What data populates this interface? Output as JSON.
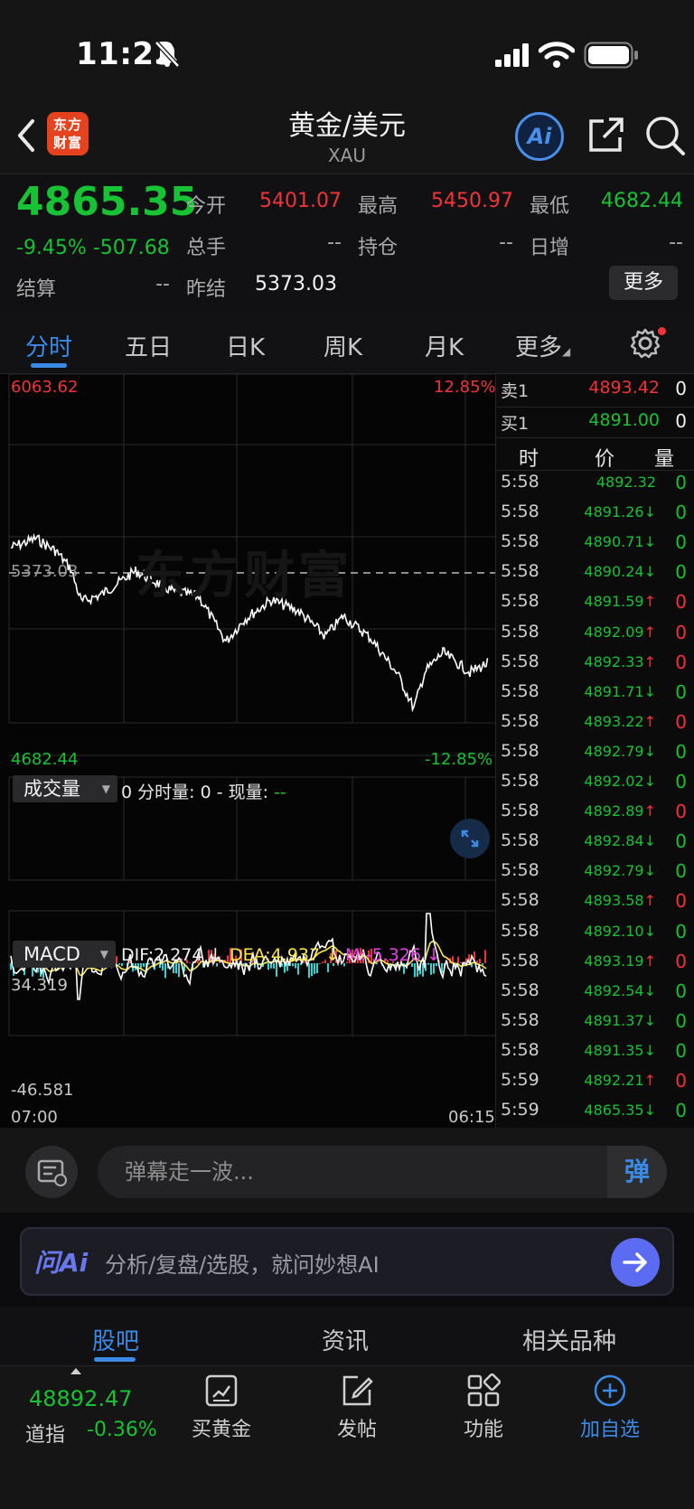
{
  "status_bar": {
    "time": "11:23"
  },
  "header": {
    "title": "黄金/美元",
    "subtitle": "XAU",
    "logo_text": "东方\n财富",
    "ai_label": "Ai"
  },
  "quote": {
    "price": "4865.35",
    "change_pct": "-9.45%",
    "change": "-507.68",
    "open_label": "今开",
    "open": "5401.07",
    "high_label": "最高",
    "high": "5450.97",
    "low_label": "最低",
    "low": "4682.44",
    "volume_label": "总手",
    "volume": "--",
    "position_label": "持仓",
    "position": "--",
    "daily_inc_label": "日增",
    "daily_inc": "--",
    "settle_label": "结算",
    "settle": "--",
    "prev_settle_label": "昨结",
    "prev_settle": "5373.03",
    "more_label": "更多"
  },
  "tabs": [
    "分时",
    "五日",
    "日K",
    "周K",
    "月K",
    "更多"
  ],
  "chart": {
    "price_top": "6063.62",
    "price_bottom": "4682.44",
    "pct_top": "12.85%",
    "pct_bottom": "-12.85%",
    "ref_price": "5373.03",
    "watermark": "东方财富",
    "volume_selector": "成交量",
    "volume_info": "0 分时量: 0 - 现量: ",
    "volume_current": "--",
    "macd_selector": "MACD",
    "dif": "DIF:2.274 ↓",
    "dea": "DEA:4.937 ↓",
    "m": "M:-5.326 ↓",
    "macd_top": "34.319",
    "macd_bottom": "-46.581",
    "time_start": "07:00",
    "time_end": "06:15",
    "colors": {
      "up": "#f0343a",
      "down": "#18c235",
      "dif": "#fff6b0",
      "dea": "#ffffff",
      "macd_neg": "#2dd6d6"
    }
  },
  "order_book": {
    "ask_label": "卖1",
    "ask_price": "4893.42",
    "ask_vol": "0",
    "bid_label": "买1",
    "bid_price": "4891.00",
    "bid_vol": "0",
    "headers": [
      "时",
      "价",
      "量"
    ]
  },
  "ticks": [
    {
      "t": "5:58",
      "p": "4892.32",
      "a": "",
      "v": "0",
      "c": "g"
    },
    {
      "t": "5:58",
      "p": "4891.26",
      "a": "↓",
      "v": "0",
      "c": "g"
    },
    {
      "t": "5:58",
      "p": "4890.71",
      "a": "↓",
      "v": "0",
      "c": "g"
    },
    {
      "t": "5:58",
      "p": "4890.24",
      "a": "↓",
      "v": "0",
      "c": "g"
    },
    {
      "t": "5:58",
      "p": "4891.59",
      "a": "↑",
      "v": "0",
      "c": "r"
    },
    {
      "t": "5:58",
      "p": "4892.09",
      "a": "↑",
      "v": "0",
      "c": "r"
    },
    {
      "t": "5:58",
      "p": "4892.33",
      "a": "↑",
      "v": "0",
      "c": "r"
    },
    {
      "t": "5:58",
      "p": "4891.71",
      "a": "↓",
      "v": "0",
      "c": "g"
    },
    {
      "t": "5:58",
      "p": "4893.22",
      "a": "↑",
      "v": "0",
      "c": "r"
    },
    {
      "t": "5:58",
      "p": "4892.79",
      "a": "↓",
      "v": "0",
      "c": "g"
    },
    {
      "t": "5:58",
      "p": "4892.02",
      "a": "↓",
      "v": "0",
      "c": "g"
    },
    {
      "t": "5:58",
      "p": "4892.89",
      "a": "↑",
      "v": "0",
      "c": "r"
    },
    {
      "t": "5:58",
      "p": "4892.84",
      "a": "↓",
      "v": "0",
      "c": "g"
    },
    {
      "t": "5:58",
      "p": "4892.79",
      "a": "↓",
      "v": "0",
      "c": "g"
    },
    {
      "t": "5:58",
      "p": "4893.58",
      "a": "↑",
      "v": "0",
      "c": "r"
    },
    {
      "t": "5:58",
      "p": "4892.10",
      "a": "↓",
      "v": "0",
      "c": "g"
    },
    {
      "t": "5:58",
      "p": "4893.19",
      "a": "↑",
      "v": "0",
      "c": "r"
    },
    {
      "t": "5:58",
      "p": "4892.54",
      "a": "↓",
      "v": "0",
      "c": "g"
    },
    {
      "t": "5:58",
      "p": "4891.37",
      "a": "↓",
      "v": "0",
      "c": "g"
    },
    {
      "t": "5:58",
      "p": "4891.35",
      "a": "↓",
      "v": "0",
      "c": "g"
    },
    {
      "t": "5:59",
      "p": "4892.21",
      "a": "↑",
      "v": "0",
      "c": "r"
    },
    {
      "t": "5:59",
      "p": "4865.35",
      "a": "↓",
      "v": "0",
      "c": "g"
    }
  ],
  "danmu": {
    "placeholder": "弹幕走一波...",
    "button": "弹"
  },
  "ask_ai": {
    "logo": "问Ai",
    "placeholder": "分析/复盘/选股，就问妙想AI"
  },
  "bottom_tabs": [
    "股吧",
    "资讯",
    "相关品种"
  ],
  "footer": {
    "index_value": "48892.47",
    "index_name": "道指",
    "index_pct": "-0.36%",
    "buttons": [
      "买黄金",
      "发帖",
      "功能",
      "加自选"
    ]
  }
}
